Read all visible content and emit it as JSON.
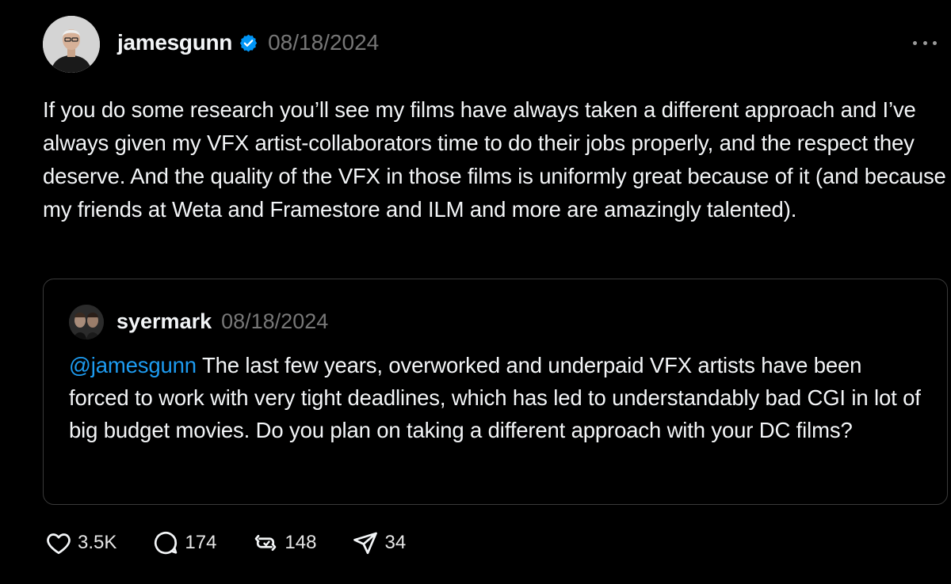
{
  "post": {
    "username": "jamesgunn",
    "date": "08/18/2024",
    "text": "If you do some research you’ll see my films have always taken a different approach and I’ve always given my VFX artist-collaborators time to do their jobs properly, and the respect they deserve. And the quality of the VFX in those films is uniformly great because of it (and because my friends at Weta and Framestore and ILM and more are amazingly talented).",
    "verified_icon": "verified-badge-icon",
    "more_icon": "more-options-icon"
  },
  "quoted": {
    "username": "syermark",
    "date": "08/18/2024",
    "mention": "@jamesgunn",
    "text": " The last few years, overworked and underpaid VFX artists have been forced to work with very tight deadlines, which has led to understandably bad CGI in lot of big budget movies. Do you plan on taking a different approach with your DC films?"
  },
  "actions": {
    "likes": "3.5K",
    "replies": "174",
    "reposts": "148",
    "shares": "34"
  },
  "colors": {
    "background": "#000000",
    "text": "#f3f5f7",
    "muted": "#777777",
    "mention": "#1d9bf0",
    "verified": "#0095f6",
    "border": "#3a3a3a"
  }
}
